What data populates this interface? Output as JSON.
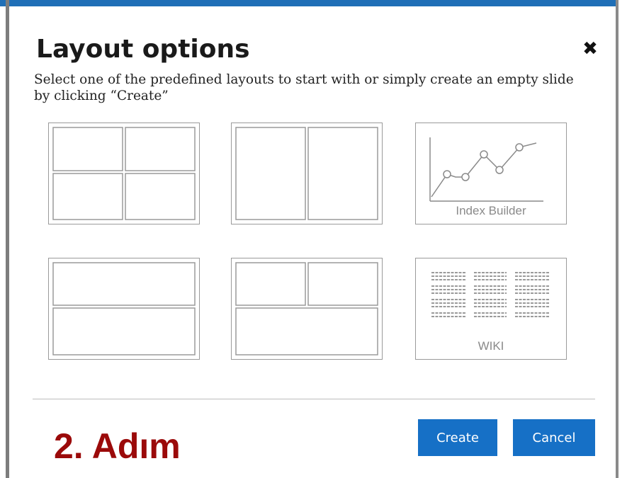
{
  "dialog": {
    "title": "Layout options",
    "close_symbol": "✖",
    "description": "Select one of the predefined layouts to start with or simply create an empty slide by clicking “Create”"
  },
  "layouts": [
    {
      "id": "grid-2x2",
      "caption": ""
    },
    {
      "id": "two-columns",
      "caption": ""
    },
    {
      "id": "index-builder",
      "caption": "Index Builder",
      "icon": "line-chart-icon"
    },
    {
      "id": "two-rows",
      "caption": ""
    },
    {
      "id": "two-top-one-bottom",
      "caption": ""
    },
    {
      "id": "wiki",
      "caption": "WIKI",
      "icon": "text-columns-icon"
    }
  ],
  "footer": {
    "step_label": "2. Adım",
    "create_label": "Create",
    "cancel_label": "Cancel"
  },
  "colors": {
    "accent": "#1670c6",
    "step_label": "#9b0a0a",
    "card_border": "#9a9a9a"
  }
}
